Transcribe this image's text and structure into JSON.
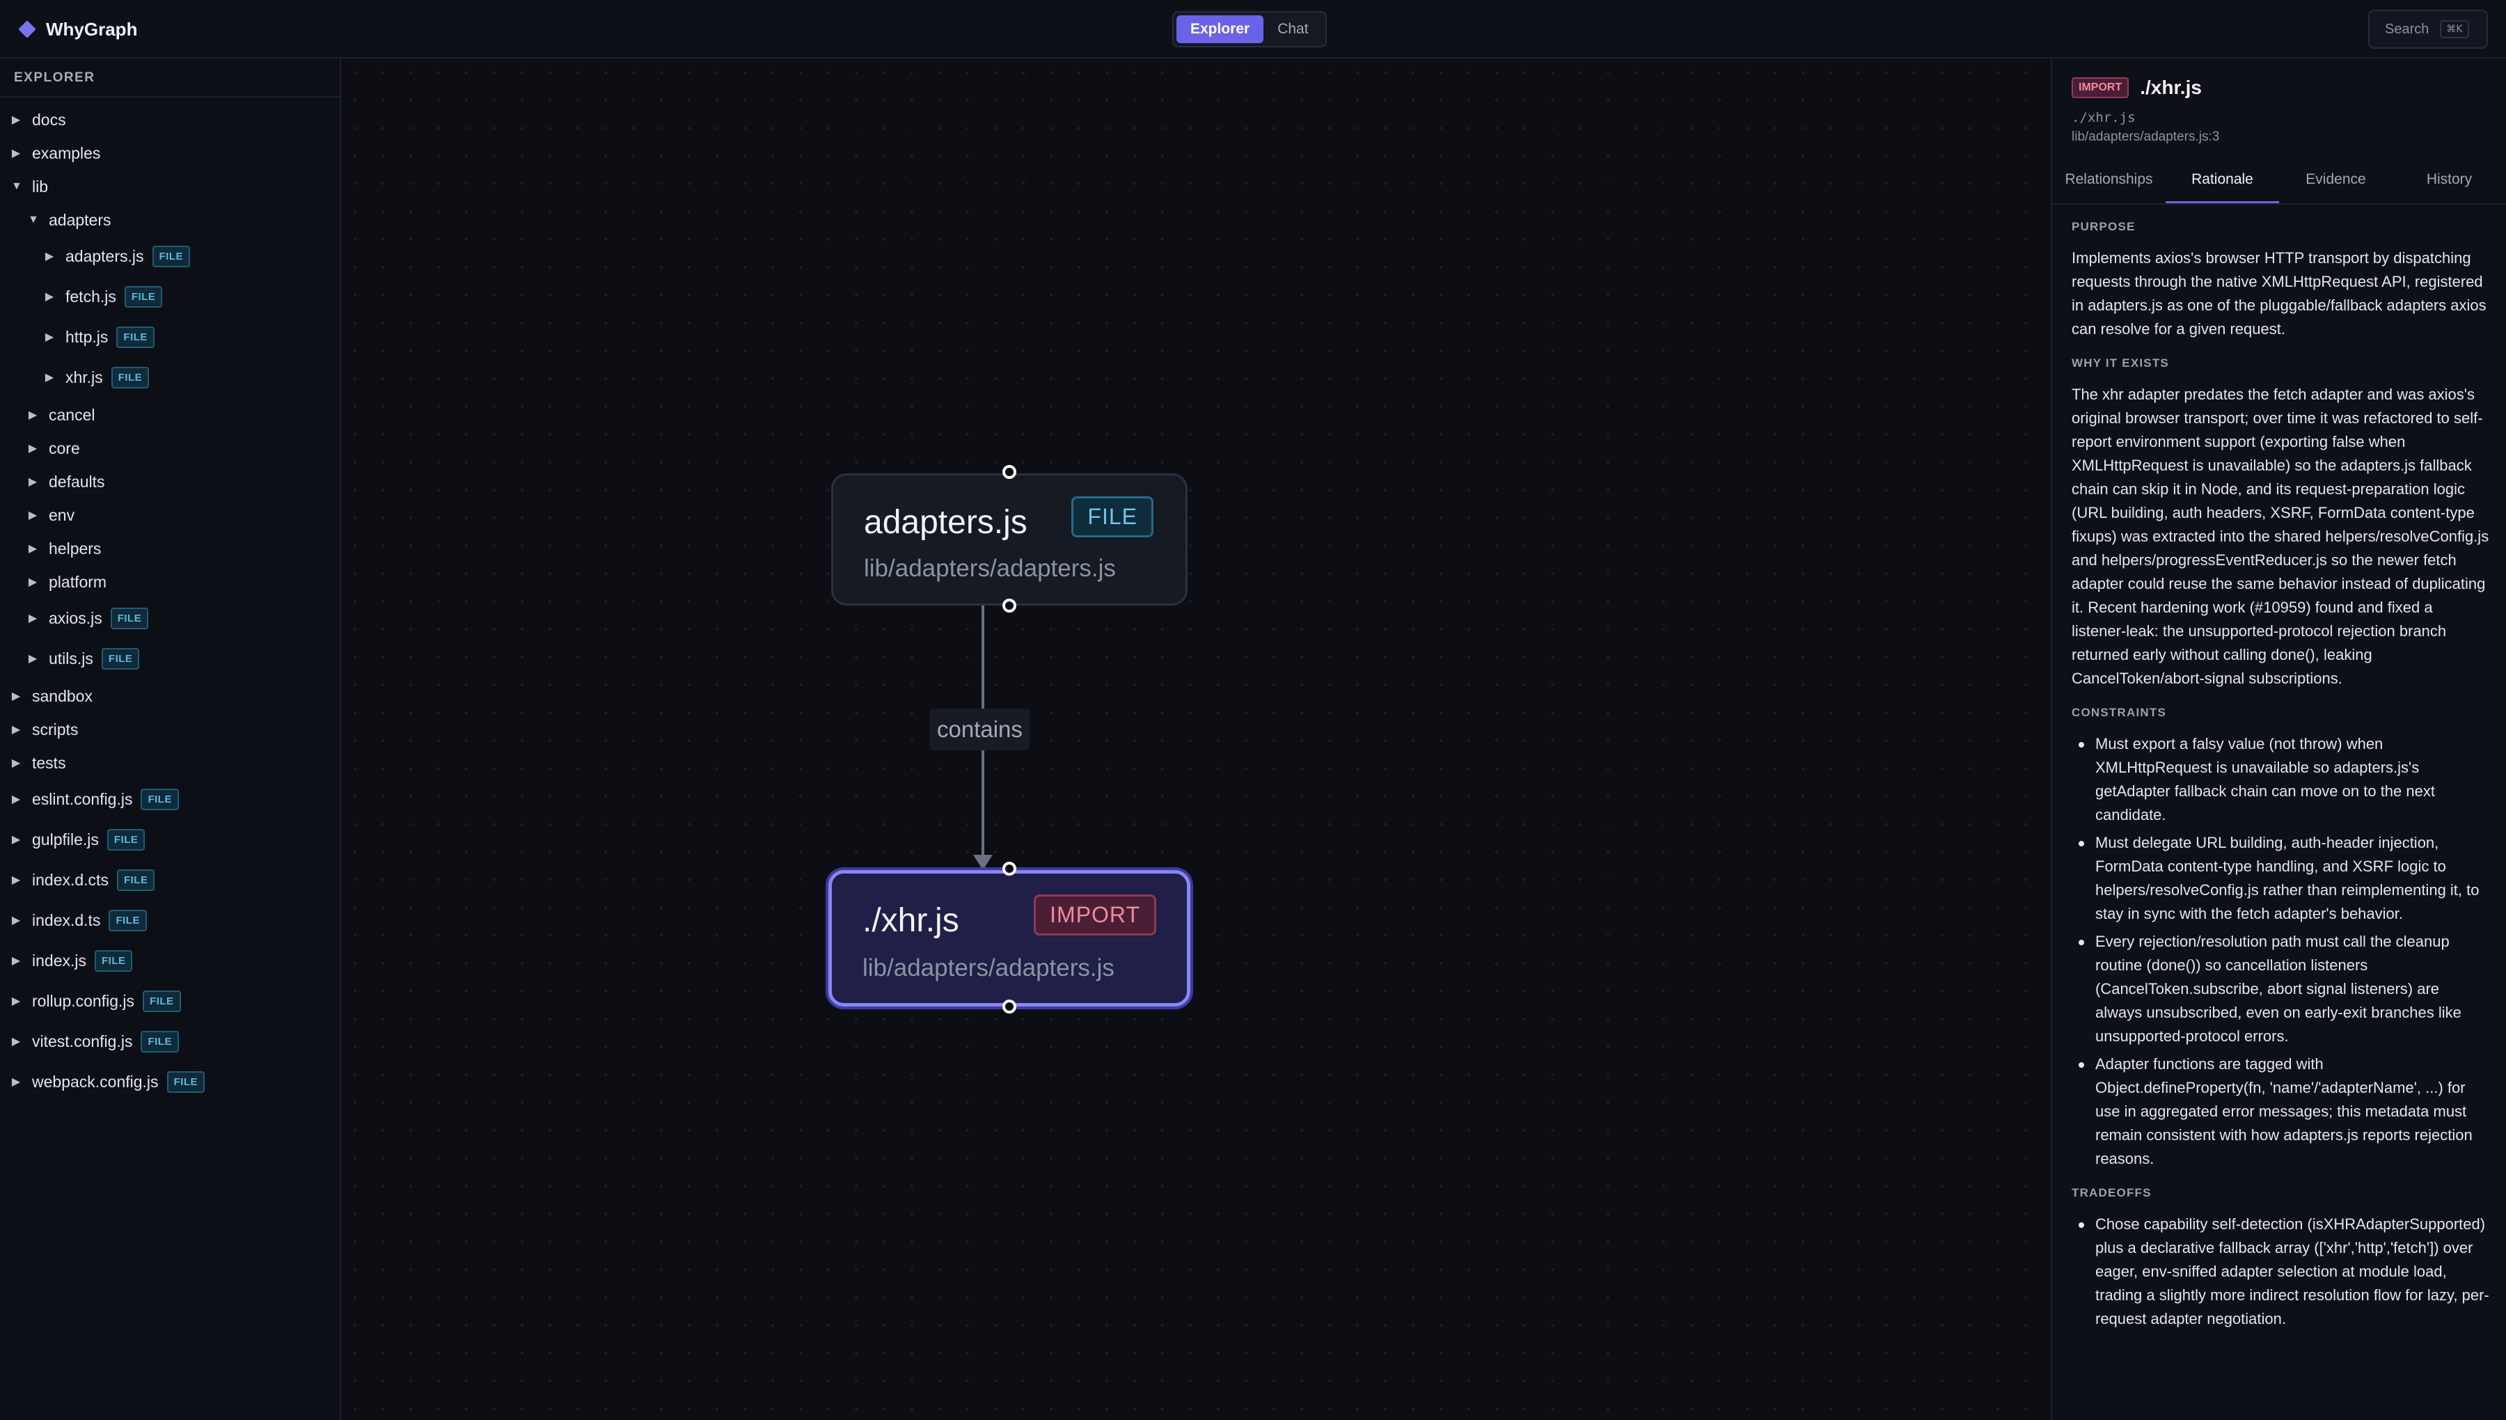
{
  "app": {
    "name": "WhyGraph"
  },
  "modes": [
    {
      "label": "Explorer",
      "active": true
    },
    {
      "label": "Chat",
      "active": false
    }
  ],
  "search": {
    "label": "Search",
    "shortcut": "⌘K"
  },
  "sidebar": {
    "header": "EXPLORER",
    "items": [
      {
        "name": "docs",
        "depth": 0,
        "expanded": false,
        "file": false
      },
      {
        "name": "examples",
        "depth": 0,
        "expanded": false,
        "file": false
      },
      {
        "name": "lib",
        "depth": 0,
        "expanded": true,
        "file": false
      },
      {
        "name": "adapters",
        "depth": 1,
        "expanded": true,
        "file": false
      },
      {
        "name": "adapters.js",
        "depth": 2,
        "expanded": false,
        "file": true
      },
      {
        "name": "fetch.js",
        "depth": 2,
        "expanded": false,
        "file": true
      },
      {
        "name": "http.js",
        "depth": 2,
        "expanded": false,
        "file": true
      },
      {
        "name": "xhr.js",
        "depth": 2,
        "expanded": false,
        "file": true
      },
      {
        "name": "cancel",
        "depth": 1,
        "expanded": false,
        "file": false
      },
      {
        "name": "core",
        "depth": 1,
        "expanded": false,
        "file": false
      },
      {
        "name": "defaults",
        "depth": 1,
        "expanded": false,
        "file": false
      },
      {
        "name": "env",
        "depth": 1,
        "expanded": false,
        "file": false
      },
      {
        "name": "helpers",
        "depth": 1,
        "expanded": false,
        "file": false
      },
      {
        "name": "platform",
        "depth": 1,
        "expanded": false,
        "file": false
      },
      {
        "name": "axios.js",
        "depth": 1,
        "expanded": false,
        "file": true
      },
      {
        "name": "utils.js",
        "depth": 1,
        "expanded": false,
        "file": true
      },
      {
        "name": "sandbox",
        "depth": 0,
        "expanded": false,
        "file": false
      },
      {
        "name": "scripts",
        "depth": 0,
        "expanded": false,
        "file": false
      },
      {
        "name": "tests",
        "depth": 0,
        "expanded": false,
        "file": false
      },
      {
        "name": "eslint.config.js",
        "depth": 0,
        "expanded": false,
        "file": true
      },
      {
        "name": "gulpfile.js",
        "depth": 0,
        "expanded": false,
        "file": true
      },
      {
        "name": "index.d.cts",
        "depth": 0,
        "expanded": false,
        "file": true
      },
      {
        "name": "index.d.ts",
        "depth": 0,
        "expanded": false,
        "file": true
      },
      {
        "name": "index.js",
        "depth": 0,
        "expanded": false,
        "file": true
      },
      {
        "name": "rollup.config.js",
        "depth": 0,
        "expanded": false,
        "file": true
      },
      {
        "name": "vitest.config.js",
        "depth": 0,
        "expanded": false,
        "file": true
      },
      {
        "name": "webpack.config.js",
        "depth": 0,
        "expanded": false,
        "file": true
      }
    ],
    "file_badge": "FILE"
  },
  "graph": {
    "nodes": [
      {
        "id": "adapters",
        "title": "adapters.js",
        "badge": "FILE",
        "path": "lib/adapters/adapters.js"
      },
      {
        "id": "xhr",
        "title": "./xhr.js",
        "badge": "IMPORT",
        "path": "lib/adapters/adapters.js",
        "selected": true
      }
    ],
    "edge_label": "contains"
  },
  "details": {
    "kind_badge": "IMPORT",
    "title": "./xhr.js",
    "subtitle": "./xhr.js",
    "location": "lib/adapters/adapters.js:3",
    "tabs": [
      {
        "label": "Relationships",
        "active": false
      },
      {
        "label": "Rationale",
        "active": true
      },
      {
        "label": "Evidence",
        "active": false
      },
      {
        "label": "History",
        "active": false
      }
    ],
    "purpose_title": "PURPOSE",
    "purpose": "Implements axios's browser HTTP transport by dispatching requests through the native XMLHttpRequest API, registered in adapters.js as one of the pluggable/fallback adapters axios can resolve for a given request.",
    "why_title": "WHY IT EXISTS",
    "why": "The xhr adapter predates the fetch adapter and was axios's original browser transport; over time it was refactored to self-report environment support (exporting false when XMLHttpRequest is unavailable) so the adapters.js fallback chain can skip it in Node, and its request-preparation logic (URL building, auth headers, XSRF, FormData content-type fixups) was extracted into the shared helpers/resolveConfig.js and helpers/progressEventReducer.js so the newer fetch adapter could reuse the same behavior instead of duplicating it. Recent hardening work (#10959) found and fixed a listener-leak: the unsupported-protocol rejection branch returned early without calling done(), leaking CancelToken/abort-signal subscriptions.",
    "constraints_title": "CONSTRAINTS",
    "constraints": [
      "Must export a falsy value (not throw) when XMLHttpRequest is unavailable so adapters.js's getAdapter fallback chain can move on to the next candidate.",
      "Must delegate URL building, auth-header injection, FormData content-type handling, and XSRF logic to helpers/resolveConfig.js rather than reimplementing it, to stay in sync with the fetch adapter's behavior.",
      "Every rejection/resolution path must call the cleanup routine (done()) so cancellation listeners (CancelToken.subscribe, abort signal listeners) are always unsubscribed, even on early-exit branches like unsupported-protocol errors.",
      "Adapter functions are tagged with Object.defineProperty(fn, 'name'/'adapterName', ...) for use in aggregated error messages; this metadata must remain consistent with how adapters.js reports rejection reasons."
    ],
    "tradeoffs_title": "TRADEOFFS",
    "tradeoffs": [
      "Chose capability self-detection (isXHRAdapterSupported) plus a declarative fallback array (['xhr','http','fetch']) over eager, env-sniffed adapter selection at module load, trading a slightly more indirect resolution flow for lazy, per-request adapter negotiation."
    ]
  },
  "colors": {
    "accent": "#6a62e8",
    "selected_node_border": "#8b84f2",
    "file_badge": "#5ab8df",
    "import_badge": "#f08aa0"
  }
}
